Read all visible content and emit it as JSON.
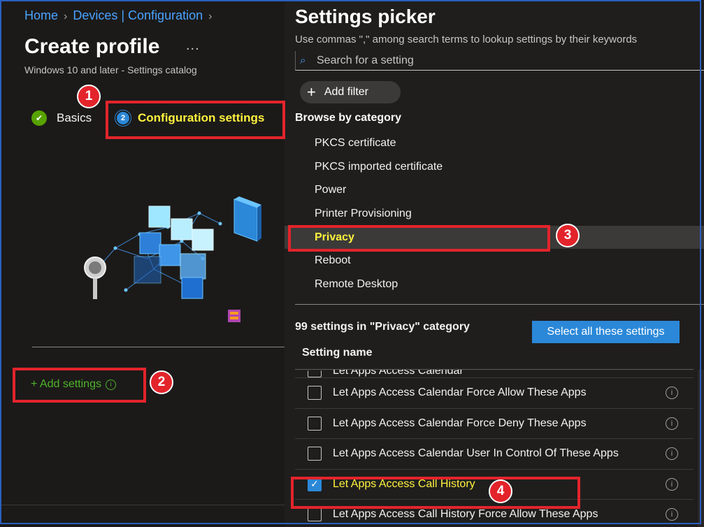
{
  "breadcrumb": [
    "Home",
    "Devices | Configuration"
  ],
  "page": {
    "title": "Create profile",
    "more": "...",
    "subtitle": "Windows 10 and later - Settings catalog"
  },
  "steps": [
    {
      "label": "Basics",
      "state": "complete"
    },
    {
      "number": "2",
      "label": "Configuration settings",
      "state": "current"
    }
  ],
  "add_settings": {
    "label": "+ Add settings",
    "info": "i"
  },
  "picker": {
    "title": "Settings picker",
    "description": "Use commas \",\" among search terms to lookup settings by their keywords",
    "search_placeholder": "Search for a setting",
    "add_filter": "Add filter",
    "browse_heading": "Browse by category",
    "categories": [
      "PKCS certificate",
      "PKCS imported certificate",
      "Power",
      "Printer Provisioning",
      "Privacy",
      "Reboot",
      "Remote Desktop"
    ],
    "selected_category": "Privacy",
    "count_text": "99 settings in \"Privacy\" category",
    "select_all": "Select all these settings",
    "column_header": "Setting name",
    "settings": [
      {
        "name": "Let Apps Access Calendar",
        "checked": false,
        "partial": true
      },
      {
        "name": "Let Apps Access Calendar Force Allow These Apps",
        "checked": false
      },
      {
        "name": "Let Apps Access Calendar Force Deny These Apps",
        "checked": false
      },
      {
        "name": "Let Apps Access Calendar User In Control Of These Apps",
        "checked": false
      },
      {
        "name": "Let Apps Access Call History",
        "checked": true
      },
      {
        "name": "Let Apps Access Call History Force Allow These Apps",
        "checked": false
      }
    ]
  },
  "annotations": [
    "1",
    "2",
    "3",
    "4"
  ],
  "colors": {
    "highlight": "#fff23d",
    "annotation": "#e3242b",
    "accent": "#2b88d8",
    "link": "#4aa3ff"
  }
}
